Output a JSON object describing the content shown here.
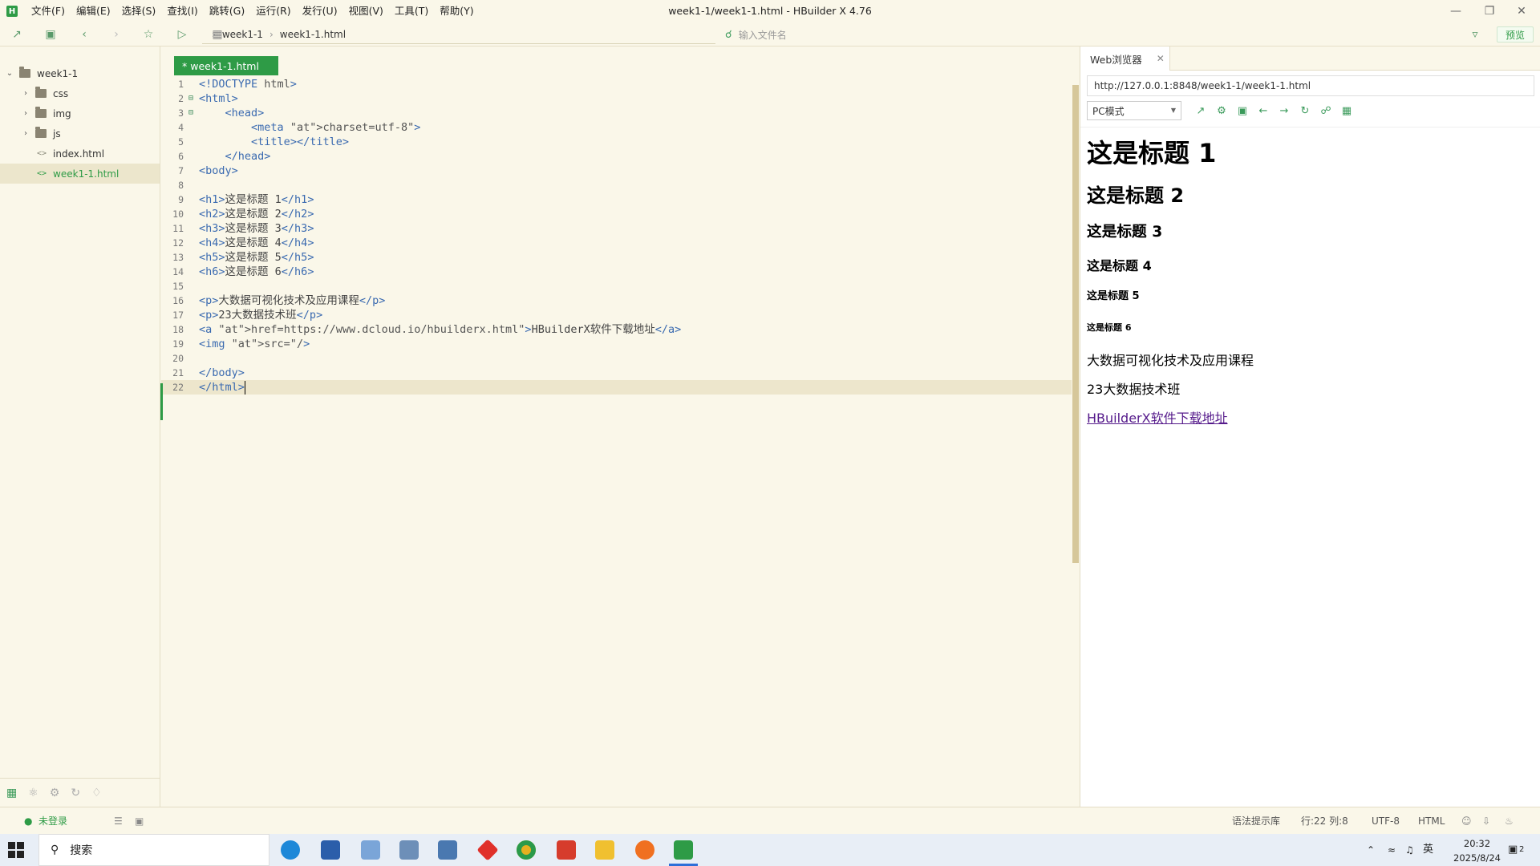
{
  "window": {
    "title": "week1-1/week1-1.html - HBuilder X 4.76",
    "logo": "H",
    "controls": [
      "minimize-icon",
      "restore-icon",
      "close-icon"
    ]
  },
  "menu": [
    "文件(F)",
    "编辑(E)",
    "选择(S)",
    "查找(I)",
    "跳转(G)",
    "运行(R)",
    "发行(U)",
    "视图(V)",
    "工具(T)",
    "帮助(Y)"
  ],
  "toolbar": {
    "breadcrumb": [
      "week1-1",
      "week1-1.html"
    ],
    "search_placeholder": "输入文件名",
    "preview_label": "预览"
  },
  "sidebar": {
    "project": "week1-1",
    "items": [
      {
        "label": "css",
        "type": "folder"
      },
      {
        "label": "img",
        "type": "folder"
      },
      {
        "label": "js",
        "type": "folder"
      },
      {
        "label": "index.html",
        "type": "file"
      },
      {
        "label": "week1-1.html",
        "type": "file",
        "selected": true
      }
    ],
    "bottom_icons": [
      "folder-icon",
      "git-icon",
      "settings-icon",
      "refresh-icon",
      "plugin-icon"
    ]
  },
  "editor": {
    "tab_label": "* week1-1.html",
    "lines": [
      "<!DOCTYPE html>",
      "<html>",
      "    <head>",
      "        <meta charset=\"utf-8\">",
      "        <title></title>",
      "    </head>",
      "<body>",
      "",
      "<h1>这是标题 1</h1>",
      "<h2>这是标题 2</h2>",
      "<h3>这是标题 3</h3>",
      "<h4>这是标题 4</h4>",
      "<h5>这是标题 5</h5>",
      "<h6>这是标题 6</h6>",
      "",
      "<p>大数据可视化技术及应用课程</p>",
      "<p>23大数据技术班</p>",
      "<a href=\"https://www.dcloud.io/hbuilderx.html\">HBuilderX软件下载地址</a>",
      "<img src=\"\"/>",
      "",
      "</body>",
      "</html>"
    ]
  },
  "browser": {
    "tab_label": "Web浏览器",
    "url": "http://127.0.0.1:8848/week1-1/week1-1.html",
    "mode": "PC模式",
    "h1": "这是标题 1",
    "h2": "这是标题 2",
    "h3": "这是标题 3",
    "h4": "这是标题 4",
    "h5": "这是标题 5",
    "h6": "这是标题 6",
    "p1": "大数据可视化技术及应用课程",
    "p2": "23大数据技术班",
    "link": "HBuilderX软件下载地址"
  },
  "status": {
    "login": "未登录",
    "syntax": "语法提示库",
    "position": "行:22  列:8",
    "encoding": "UTF-8",
    "language": "HTML"
  },
  "taskbar": {
    "search_label": "搜索",
    "time": "20:32",
    "date": "2025/8/24",
    "ime": "英",
    "notification_count": "2"
  },
  "colors": {
    "accent": "#2e9b46",
    "background": "#faf7e9",
    "tag": "#3a6ab0",
    "attribute": "#c0392b",
    "string": "#1f7a5c"
  }
}
